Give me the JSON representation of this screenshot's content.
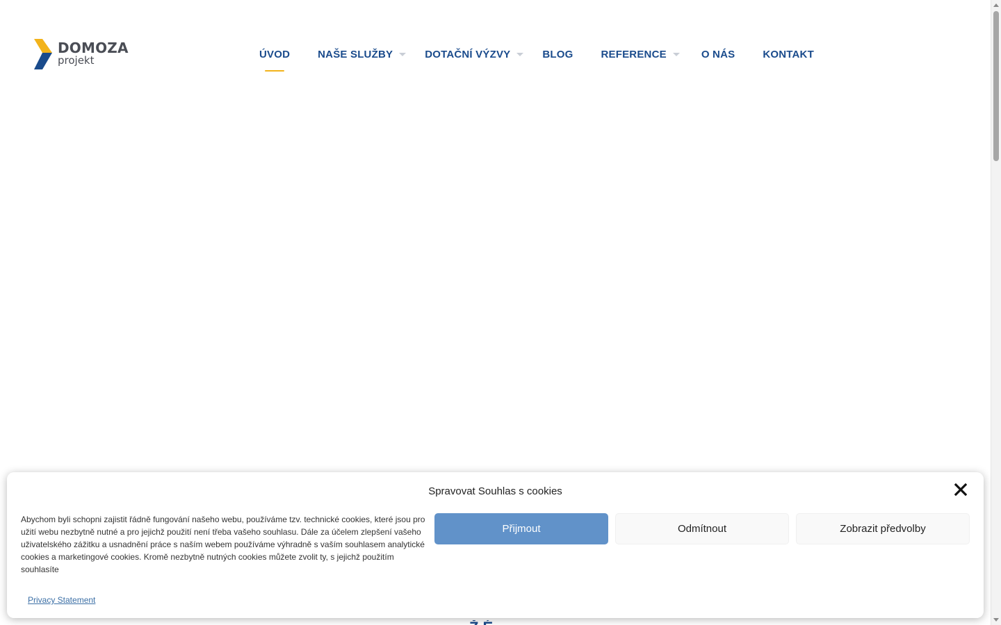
{
  "brand": {
    "name": "DOMOZA",
    "subtitle": "projekt",
    "colors": {
      "navy": "#1a4b8c",
      "yellow": "#f2b31b",
      "gray": "#4a4d55"
    }
  },
  "nav": {
    "items": [
      {
        "label": "ÚVOD",
        "has_dropdown": false,
        "active": true
      },
      {
        "label": "NAŠE SLUŽBY",
        "has_dropdown": true,
        "active": false
      },
      {
        "label": "DOTAČNÍ VÝZVY",
        "has_dropdown": true,
        "active": false
      },
      {
        "label": "BLOG",
        "has_dropdown": false,
        "active": false
      },
      {
        "label": "REFERENCE",
        "has_dropdown": true,
        "active": false
      },
      {
        "label": "O NÁS",
        "has_dropdown": false,
        "active": false
      },
      {
        "label": "KONTAKT",
        "has_dropdown": false,
        "active": false
      }
    ]
  },
  "cookie_banner": {
    "title": "Spravovat Souhlas s cookies",
    "close_icon": "close-icon",
    "text": "Abychom byli schopni zajistit řádně fungování našeho webu, používáme tzv. technické cookies, které jsou pro užití webu nezbytně nutné a pro jejichž použití není třeba vašeho souhlasu. Dále za účelem zlepšení vašeho uživatelského zážitku a usnadnění práce s naším webem používáme výhradně s vaším souhlasem analytické cookies a marketingové cookies. Kromě nezbytně nutných cookies můžete zvolit ty, s jejichž použitím souhlasíte",
    "accept_label": "Přijmout",
    "deny_label": "Odmítnout",
    "preferences_label": "Zobrazit předvolby",
    "privacy_link": "Privacy Statement",
    "accent_color": "#6192c9"
  }
}
